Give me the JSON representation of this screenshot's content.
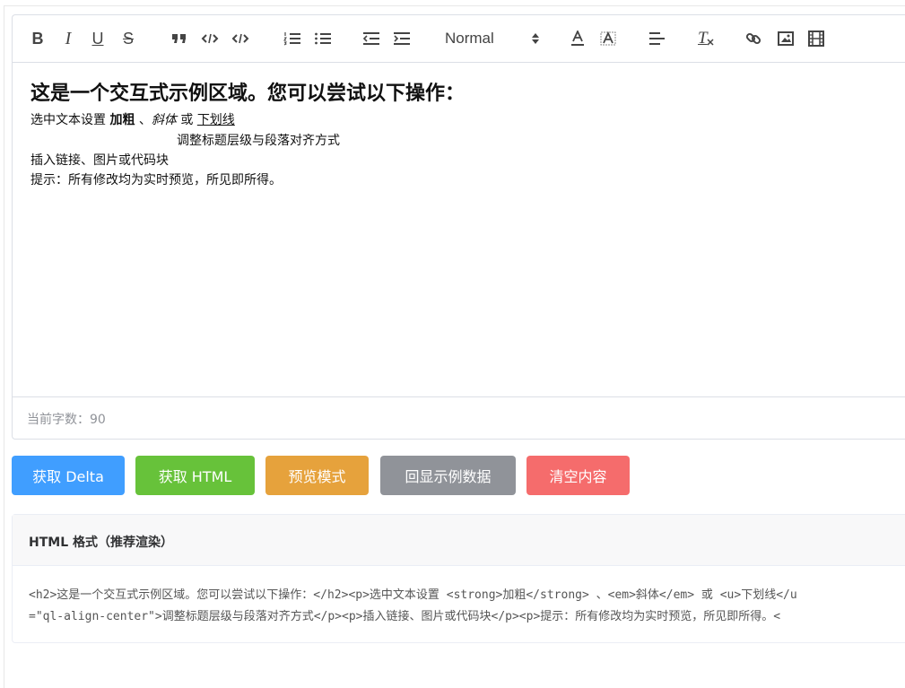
{
  "toolbar": {
    "header_select": "Normal",
    "icons": [
      "bold-icon",
      "italic-icon",
      "underline-icon",
      "strike-icon",
      "blockquote-icon",
      "code-icon",
      "code-block-icon",
      "ordered-list-icon",
      "bullet-list-icon",
      "outdent-icon",
      "indent-icon",
      "font-color-icon",
      "background-color-icon",
      "align-icon",
      "clean-format-icon",
      "link-icon",
      "image-icon",
      "video-icon"
    ],
    "bold": "B",
    "italic": "I",
    "underline": "U",
    "strike": "S",
    "clean": "T"
  },
  "content": {
    "heading": "这是一个交互式示例区域。您可以尝试以下操作：",
    "line1_prefix": "选中文本设置 ",
    "line1_bold": "加粗",
    "line1_sep": " 、",
    "line1_italic": "斜体",
    "line1_or": " 或 ",
    "line1_underline": "下划线",
    "line2": "调整标题层级与段落对齐方式",
    "line3": "插入链接、图片或代码块",
    "line4": "提示：所有修改均为实时预览，所见即所得。"
  },
  "word_count": "当前字数：90",
  "buttons": {
    "get_delta": "获取 Delta",
    "get_html": "获取 HTML",
    "preview": "预览模式",
    "restore": "回显示例数据",
    "clear": "清空内容"
  },
  "colors": {
    "primary": "#409eff",
    "success": "#67c23a",
    "warning": "#e6a23c",
    "info": "#909399",
    "danger": "#f56c6c"
  },
  "output": {
    "title": "HTML 格式（推荐渲染）",
    "code_line1": "<h2>这是一个交互式示例区域。您可以尝试以下操作：</h2><p>选中文本设置 <strong>加粗</strong> 、<em>斜体</em> 或 <u>下划线</u",
    "code_line2": "=\"ql-align-center\">调整标题层级与段落对齐方式</p><p>插入链接、图片或代码块</p><p>提示：所有修改均为实时预览，所见即所得。<"
  }
}
